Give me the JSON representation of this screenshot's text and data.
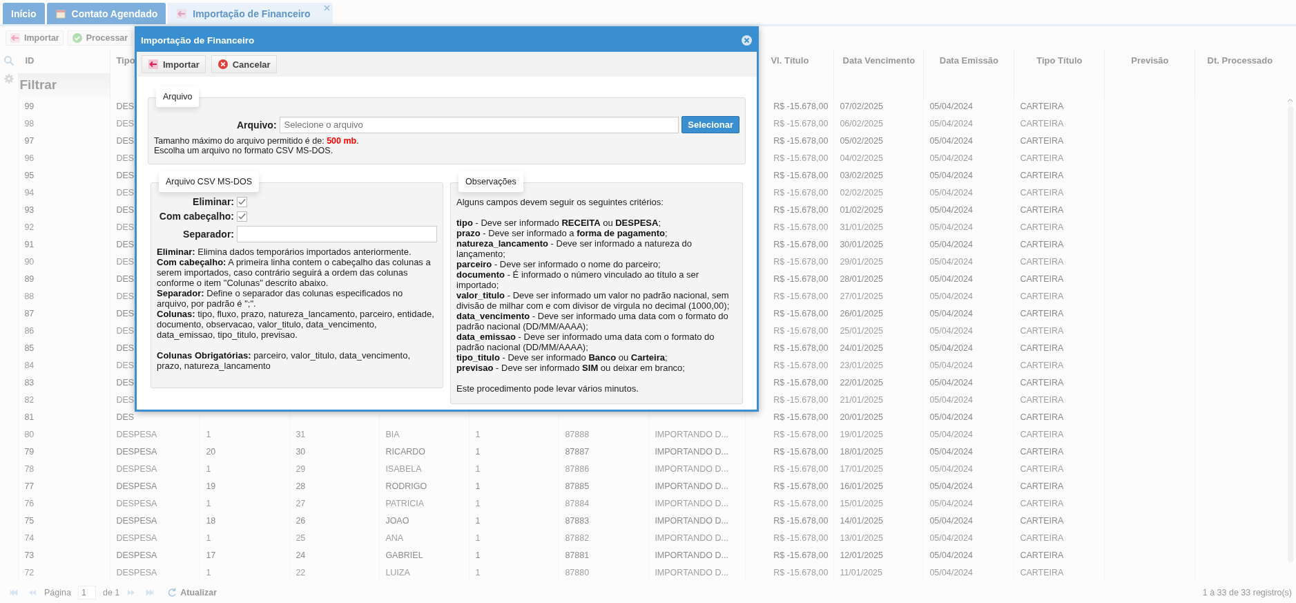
{
  "tabs": [
    {
      "label": "Início",
      "selected": false,
      "closable": false
    },
    {
      "label": "Contato Agendado",
      "selected": false,
      "closable": false
    },
    {
      "label": "Importação de Financeiro",
      "selected": true,
      "closable": true
    }
  ],
  "toolbar": [
    {
      "label": "Importar"
    },
    {
      "label": "Processar"
    }
  ],
  "table": {
    "filter_label": "Filtrar",
    "columns_left": [
      "ID",
      "Tipo"
    ],
    "columns_right": [
      "Vl. Título",
      "Data Vencimento",
      "Data Emissão",
      "Tipo Título",
      "Previsão",
      "Dt. Processado"
    ],
    "rows": [
      {
        "id": "99",
        "tipo": "DES",
        "right": [
          "R$ -15.678,00",
          "07/02/2025",
          "05/04/2024",
          "CARTEIRA"
        ]
      },
      {
        "id": "98",
        "tipo": "DES",
        "right": [
          "R$ -15.678,00",
          "06/02/2025",
          "05/04/2024",
          "CARTEIRA"
        ]
      },
      {
        "id": "97",
        "tipo": "DES",
        "right": [
          "R$ -15.678,00",
          "05/02/2025",
          "05/04/2024",
          "CARTEIRA"
        ]
      },
      {
        "id": "96",
        "tipo": "DES",
        "right": [
          "R$ -15.678,00",
          "04/02/2025",
          "05/04/2024",
          "CARTEIRA"
        ]
      },
      {
        "id": "95",
        "tipo": "DES",
        "right": [
          "R$ -15.678,00",
          "03/02/2025",
          "05/04/2024",
          "CARTEIRA"
        ]
      },
      {
        "id": "94",
        "tipo": "DES",
        "right": [
          "R$ -15.678,00",
          "02/02/2025",
          "05/04/2024",
          "CARTEIRA"
        ]
      },
      {
        "id": "93",
        "tipo": "DES",
        "right": [
          "R$ -15.678,00",
          "01/02/2025",
          "05/04/2024",
          "CARTEIRA"
        ]
      },
      {
        "id": "92",
        "tipo": "DES",
        "right": [
          "R$ -15.678,00",
          "31/01/2025",
          "05/04/2024",
          "CARTEIRA"
        ]
      },
      {
        "id": "91",
        "tipo": "DES",
        "right": [
          "R$ -15.678,00",
          "30/01/2025",
          "05/04/2024",
          "CARTEIRA"
        ]
      },
      {
        "id": "90",
        "tipo": "DES",
        "right": [
          "R$ -15.678,00",
          "29/01/2025",
          "05/04/2024",
          "CARTEIRA"
        ]
      },
      {
        "id": "89",
        "tipo": "DES",
        "right": [
          "R$ -15.678,00",
          "28/01/2025",
          "05/04/2024",
          "CARTEIRA"
        ]
      },
      {
        "id": "88",
        "tipo": "DES",
        "right": [
          "R$ -15.678,00",
          "27/01/2025",
          "05/04/2024",
          "CARTEIRA"
        ]
      },
      {
        "id": "87",
        "tipo": "DES",
        "right": [
          "R$ -15.678,00",
          "26/01/2025",
          "05/04/2024",
          "CARTEIRA"
        ]
      },
      {
        "id": "86",
        "tipo": "DES",
        "right": [
          "R$ -15.678,00",
          "25/01/2025",
          "05/04/2024",
          "CARTEIRA"
        ]
      },
      {
        "id": "85",
        "tipo": "DES",
        "right": [
          "R$ -15.678,00",
          "24/01/2025",
          "05/04/2024",
          "CARTEIRA"
        ]
      },
      {
        "id": "84",
        "tipo": "DES",
        "right": [
          "R$ -15.678,00",
          "23/01/2025",
          "05/04/2024",
          "CARTEIRA"
        ]
      },
      {
        "id": "83",
        "tipo": "DES",
        "right": [
          "R$ -15.678,00",
          "22/01/2025",
          "05/04/2024",
          "CARTEIRA"
        ]
      },
      {
        "id": "82",
        "tipo": "DES",
        "right": [
          "R$ -15.678,00",
          "21/01/2025",
          "05/04/2024",
          "CARTEIRA"
        ]
      },
      {
        "id": "81",
        "tipo": "DES",
        "right": [
          "R$ -15.678,00",
          "20/01/2025",
          "05/04/2024",
          "CARTEIRA"
        ]
      },
      {
        "id": "80",
        "tipo": "DESPESA",
        "middle": [
          "1",
          "31",
          "BIA",
          "1",
          "87888",
          "IMPORTANDO D..."
        ],
        "right": [
          "R$ -15.678,00",
          "19/01/2025",
          "05/04/2024",
          "CARTEIRA"
        ]
      },
      {
        "id": "79",
        "tipo": "DESPESA",
        "middle": [
          "20",
          "30",
          "RICARDO",
          "1",
          "87887",
          "IMPORTANDO D..."
        ],
        "right": [
          "R$ -15.678,00",
          "18/01/2025",
          "05/04/2024",
          "CARTEIRA"
        ]
      },
      {
        "id": "78",
        "tipo": "DESPESA",
        "middle": [
          "1",
          "29",
          "ISABELA",
          "1",
          "87886",
          "IMPORTANDO D..."
        ],
        "right": [
          "R$ -15.678,00",
          "17/01/2025",
          "05/04/2024",
          "CARTEIRA"
        ]
      },
      {
        "id": "77",
        "tipo": "DESPESA",
        "middle": [
          "19",
          "28",
          "RODRIGO",
          "1",
          "87885",
          "IMPORTANDO D..."
        ],
        "right": [
          "R$ -15.678,00",
          "16/01/2025",
          "05/04/2024",
          "CARTEIRA"
        ]
      },
      {
        "id": "76",
        "tipo": "DESPESA",
        "middle": [
          "1",
          "27",
          "PATRICIA",
          "1",
          "87884",
          "IMPORTANDO D..."
        ],
        "right": [
          "R$ -15.678,00",
          "15/01/2025",
          "05/04/2024",
          "CARTEIRA"
        ]
      },
      {
        "id": "75",
        "tipo": "DESPESA",
        "middle": [
          "18",
          "26",
          "JOAO",
          "1",
          "87883",
          "IMPORTANDO D..."
        ],
        "right": [
          "R$ -15.678,00",
          "14/01/2025",
          "05/04/2024",
          "CARTEIRA"
        ]
      },
      {
        "id": "74",
        "tipo": "DESPESA",
        "middle": [
          "1",
          "25",
          "ANA",
          "1",
          "87882",
          "IMPORTANDO D..."
        ],
        "right": [
          "R$ -15.678,00",
          "13/01/2025",
          "05/04/2024",
          "CARTEIRA"
        ]
      },
      {
        "id": "73",
        "tipo": "DESPESA",
        "middle": [
          "17",
          "24",
          "GABRIEL",
          "1",
          "87881",
          "IMPORTANDO D..."
        ],
        "right": [
          "R$ -15.678,00",
          "12/01/2025",
          "05/04/2024",
          "CARTEIRA"
        ]
      },
      {
        "id": "72",
        "tipo": "DESPESA",
        "middle": [
          "1",
          "22",
          "LUIZA",
          "1",
          "87880",
          "IMPORTANDO D..."
        ],
        "right": [
          "R$ -15.678,00",
          "11/01/2025",
          "05/04/2024",
          "CARTEIRA"
        ]
      }
    ]
  },
  "pager": {
    "page_label": "Página",
    "page_value": "1",
    "page_total": "de 1",
    "refresh": "Atualizar",
    "summary": "1 à 33 de 33 registro(s)"
  },
  "dialog": {
    "title": "Importação de Financeiro",
    "toolbar": [
      {
        "label": "Importar"
      },
      {
        "label": "Cancelar"
      }
    ],
    "file_section": {
      "legend": "Arquivo",
      "label": "Arquivo:",
      "placeholder": "Selecione o arquivo",
      "button": "Selecionar",
      "notes": [
        "Tamanho máximo do arquivo permitido é de: **500 mb**.",
        "Escolha um arquivo no formato CSV MS-DOS."
      ]
    },
    "csv_section": {
      "legend": "Arquivo CSV MS-DOS",
      "options": [
        {
          "kind": "checkbox",
          "label": "Eliminar:",
          "checked": true
        },
        {
          "kind": "checkbox",
          "label": "Com cabeçalho:",
          "checked": true
        },
        {
          "kind": "text",
          "label": "Separador:"
        }
      ],
      "help_groups": [
        [
          "**Eliminar:** Elimina dados temporários importados anteriormente.",
          "**Com cabeçalho:** A primeira linha contem o cabeçalho das colunas a serem importados, caso contrário seguirá a ordem das colunas conforme o item \"Colunas\" descrito abaixo.",
          "**Separador:** Define o separador das colunas especificados no arquivo, por padrão é \";\".",
          "**Colunas:** tipo, fluxo, prazo, natureza_lancamento, parceiro, entidade, documento, observacao, valor_titulo, data_vencimento, data_emissao, tipo_titulo, previsao."
        ],
        [
          "**Colunas Obrigatórias:** parceiro, valor_titulo, data_vencimento, prazo, natureza_lancamento"
        ]
      ]
    },
    "notes_section": {
      "legend": "Observações",
      "groups": [
        [
          "Alguns campos devem seguir os seguintes critérios:"
        ],
        [
          "**tipo** - Deve ser informado **RECEITA** ou **DESPESA**;",
          "**prazo** - Deve ser informado a **forma de pagamento**;",
          "**natureza_lancamento** - Deve ser informado a natureza do lançamento;",
          "**parceiro** - Deve ser informado o nome do parceiro;",
          "**documento** - É informado o número vinculado ao título a ser importado;",
          "**valor_titulo** - Deve ser informado um valor no padrão nacional, sem divisão de milhar com e com divisor de virgula no decimal (1000,00);",
          "**data_vencimento** - Deve ser informado uma data com o formato do padrão nacional (DD/MM/AAAA);",
          "**data_emissao** - Deve ser informado uma data com o formato do padrão nacional (DD/MM/AAAA);",
          "**tipo_titulo** - Deve ser informado **Banco** ou **Carteira**;",
          "**previsao** - Deve ser informado **SIM** ou deixar em branco;"
        ],
        [
          "Este procedimento pode levar vários minutos."
        ]
      ]
    }
  }
}
